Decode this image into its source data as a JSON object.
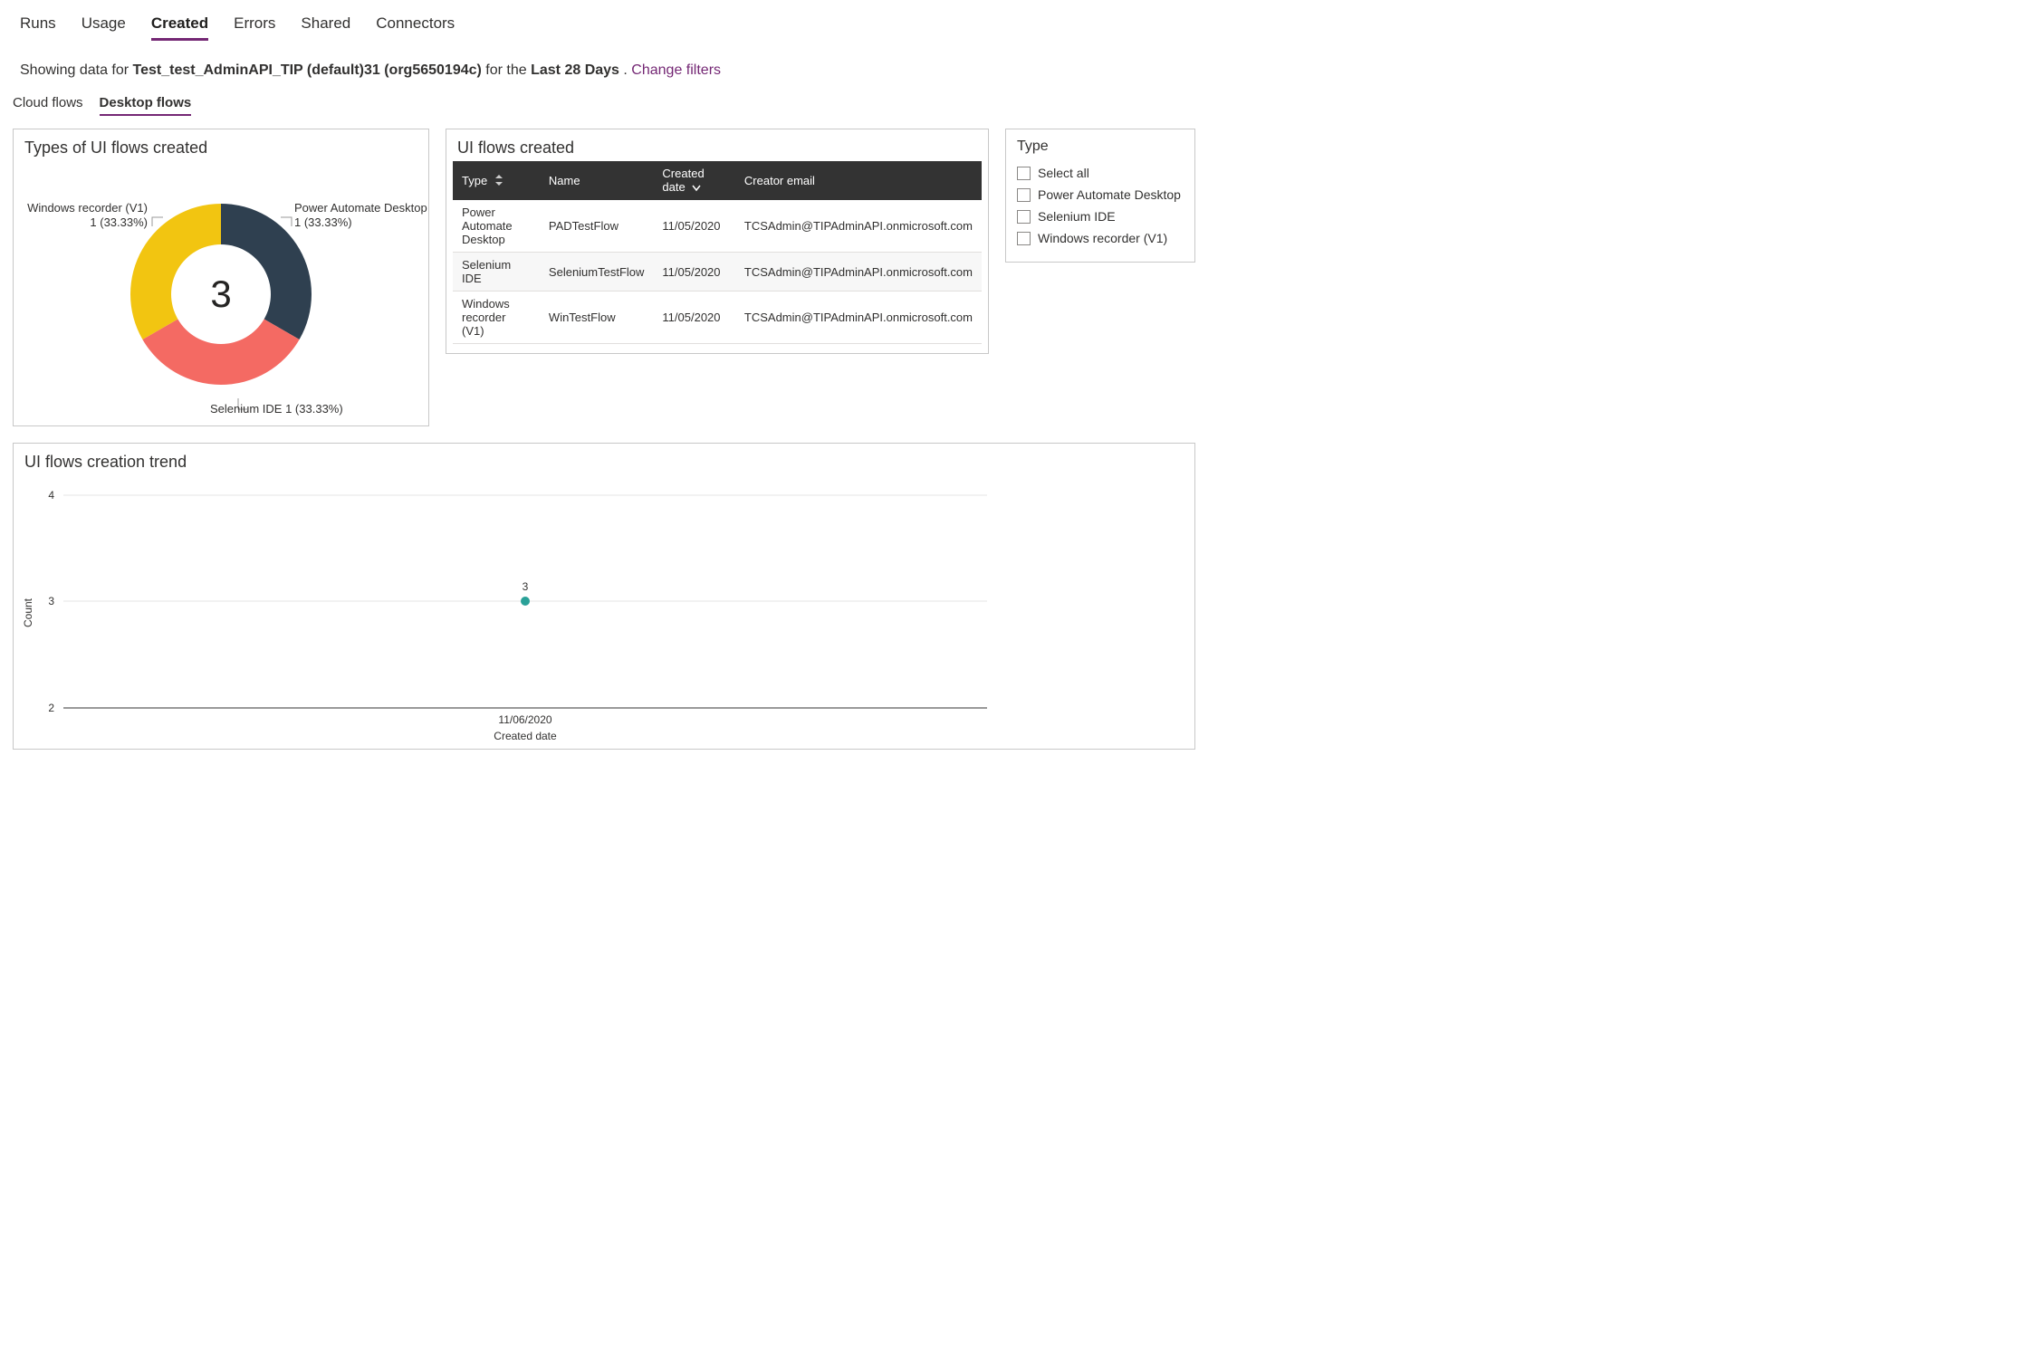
{
  "main_tabs": {
    "items": [
      "Runs",
      "Usage",
      "Created",
      "Errors",
      "Shared",
      "Connectors"
    ],
    "active_index": 2
  },
  "filter_line": {
    "prefix": "Showing data for ",
    "env": "Test_test_AdminAPI_TIP (default)31 (org5650194c)",
    "mid": " for the ",
    "period": "Last 28 Days",
    "suffix": ". ",
    "change_link": "Change filters"
  },
  "sub_tabs": {
    "items": [
      "Cloud flows",
      "Desktop flows"
    ],
    "active_index": 1
  },
  "donut": {
    "title": "Types of UI flows created",
    "center_value": "3",
    "labels": {
      "right_line1": "Power Automate Desktop",
      "right_line2": "1 (33.33%)",
      "left_line1": "Windows recorder (V1)",
      "left_line2": "1 (33.33%)",
      "bottom": "Selenium IDE 1 (33.33%)"
    }
  },
  "table": {
    "title": "UI flows created",
    "headers": {
      "type": "Type",
      "name": "Name",
      "created": "Created date",
      "creator": "Creator email"
    },
    "rows": [
      {
        "type": "Power Automate Desktop",
        "name": "PADTestFlow",
        "created": "11/05/2020",
        "creator": "TCSAdmin@TIPAdminAPI.onmicrosoft.com"
      },
      {
        "type": "Selenium IDE",
        "name": "SeleniumTestFlow",
        "created": "11/05/2020",
        "creator": "TCSAdmin@TIPAdminAPI.onmicrosoft.com"
      },
      {
        "type": "Windows recorder (V1)",
        "name": "WinTestFlow",
        "created": "11/05/2020",
        "creator": "TCSAdmin@TIPAdminAPI.onmicrosoft.com"
      }
    ]
  },
  "type_filter": {
    "title": "Type",
    "options": [
      "Select all",
      "Power Automate Desktop",
      "Selenium IDE",
      "Windows recorder (V1)"
    ]
  },
  "trend": {
    "title": "UI flows creation trend",
    "y_ticks": [
      "4",
      "3",
      "2"
    ],
    "x_tick": "11/06/2020",
    "x_label": "Created date",
    "y_label": "Count",
    "point_label": "3"
  },
  "chart_data": [
    {
      "type": "pie",
      "title": "Types of UI flows created",
      "series": [
        {
          "name": "Power Automate Desktop",
          "value": 1,
          "pct": 33.33,
          "color": "#2f4050"
        },
        {
          "name": "Windows recorder (V1)",
          "value": 1,
          "pct": 33.33,
          "color": "#f2c511"
        },
        {
          "name": "Selenium IDE",
          "value": 1,
          "pct": 33.33,
          "color": "#f46a63"
        }
      ],
      "center_total": 3
    },
    {
      "type": "table",
      "title": "UI flows created",
      "columns": [
        "Type",
        "Name",
        "Created date",
        "Creator email"
      ],
      "rows": [
        [
          "Power Automate Desktop",
          "PADTestFlow",
          "11/05/2020",
          "TCSAdmin@TIPAdminAPI.onmicrosoft.com"
        ],
        [
          "Selenium IDE",
          "SeleniumTestFlow",
          "11/05/2020",
          "TCSAdmin@TIPAdminAPI.onmicrosoft.com"
        ],
        [
          "Windows recorder (V1)",
          "WinTestFlow",
          "11/05/2020",
          "TCSAdmin@TIPAdminAPI.onmicrosoft.com"
        ]
      ],
      "sort": {
        "column": "Created date",
        "dir": "desc"
      }
    },
    {
      "type": "line",
      "title": "UI flows creation trend",
      "xlabel": "Created date",
      "ylabel": "Count",
      "ylim": [
        2,
        4
      ],
      "x": [
        "11/06/2020"
      ],
      "series": [
        {
          "name": "Count",
          "values": [
            3
          ],
          "color": "#2aa198"
        }
      ]
    }
  ]
}
